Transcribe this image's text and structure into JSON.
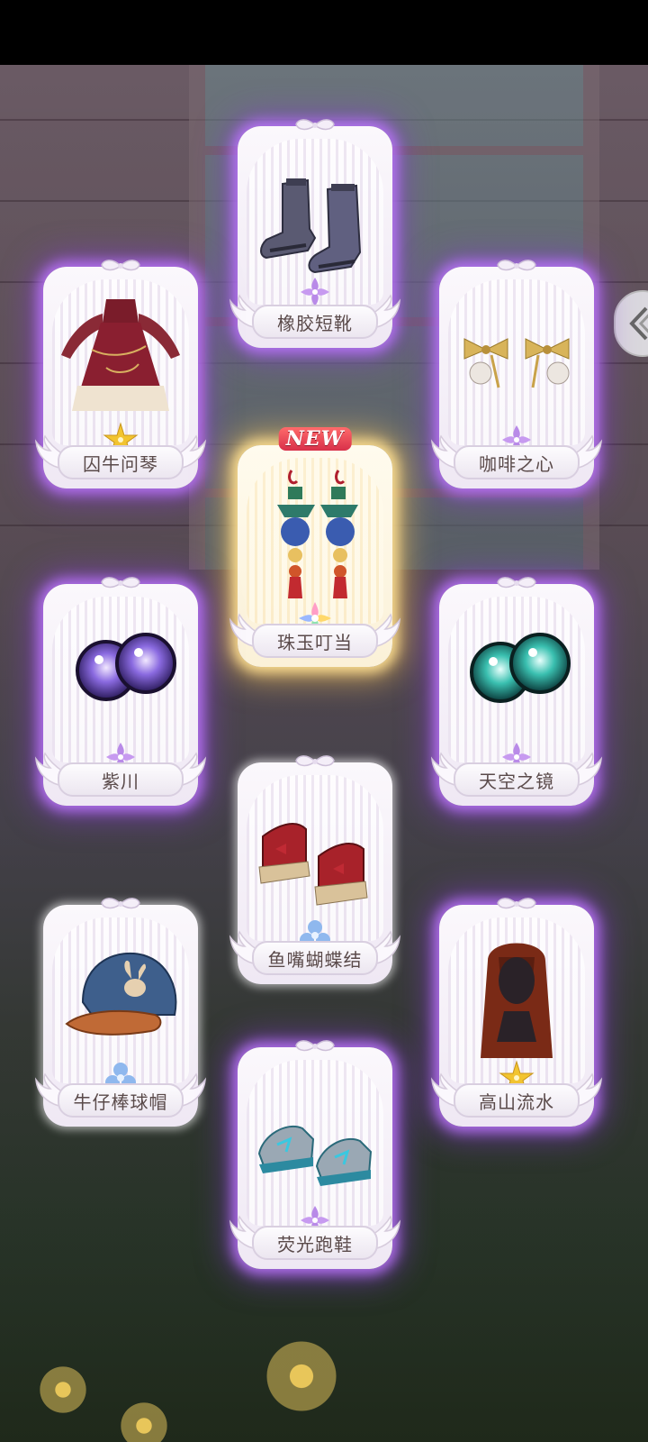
{
  "rewards": {
    "items": [
      {
        "name": "橡胶短靴",
        "rarity": "purple",
        "is_new": false
      },
      {
        "name": "囚牛问琴",
        "rarity": "gold",
        "is_new": false
      },
      {
        "name": "咖啡之心",
        "rarity": "purple",
        "is_new": false
      },
      {
        "name": "珠玉叮当",
        "rarity": "rainbow",
        "is_new": true
      },
      {
        "name": "紫川",
        "rarity": "purple",
        "is_new": false
      },
      {
        "name": "天空之镜",
        "rarity": "purple",
        "is_new": false
      },
      {
        "name": "鱼嘴蝴蝶结",
        "rarity": "blue",
        "is_new": false
      },
      {
        "name": "牛仔棒球帽",
        "rarity": "blue",
        "is_new": false
      },
      {
        "name": "高山流水",
        "rarity": "gold",
        "is_new": false
      },
      {
        "name": "荧光跑鞋",
        "rarity": "purple",
        "is_new": false
      }
    ],
    "new_badge": "NEW"
  },
  "colors": {
    "purple_glow": "#b070ff",
    "gold_glow": "#ffd27a",
    "label_text": "#5a4a4a"
  },
  "icons": {
    "side_nav": "diamond-arrow-icon"
  }
}
